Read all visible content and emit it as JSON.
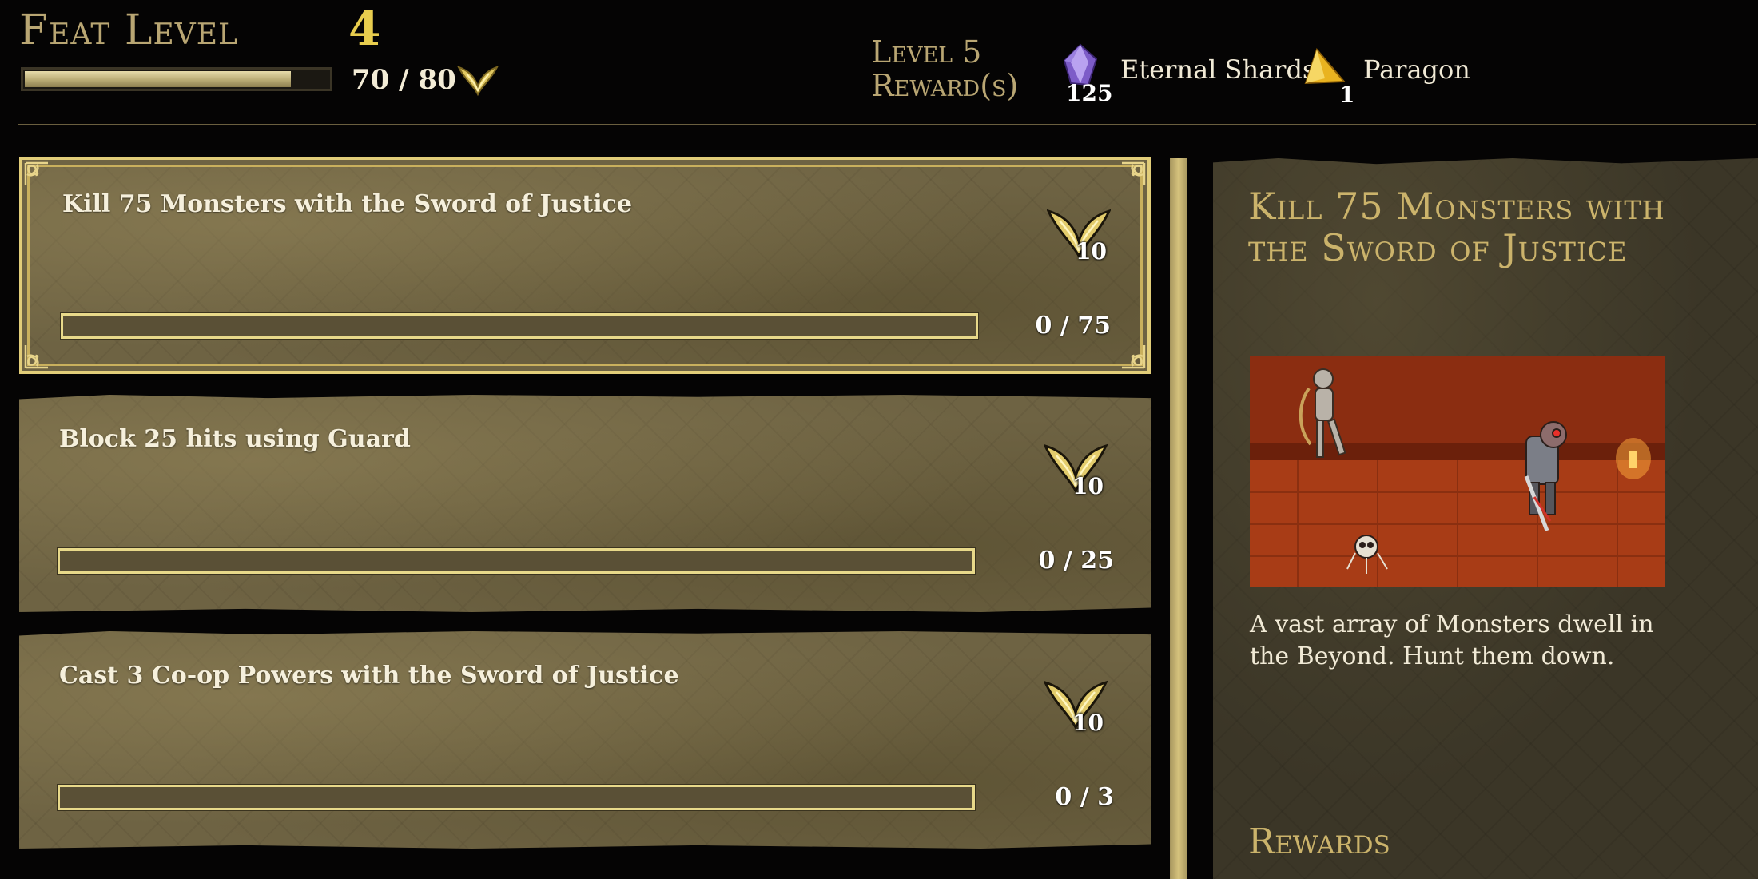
{
  "header": {
    "feat_label": "Feat Level",
    "feat_level": "4",
    "xp_text": "70 / 80",
    "xp_progress": 0.875,
    "reward_title": "Level 5 Reward(s)",
    "rewards": [
      {
        "count": "125",
        "label": "Eternal Shards",
        "icon": "purple-crystal-icon"
      },
      {
        "count": "1",
        "label": "Paragon",
        "icon": "gold-triangle-icon"
      }
    ]
  },
  "feats": [
    {
      "title": "Kill 75 Monsters with the Sword of Justice",
      "reward": "10",
      "progress_text": "0 / 75",
      "progress": 0,
      "selected": true
    },
    {
      "title": "Block 25 hits using Guard",
      "reward": "10",
      "progress_text": "0 / 25",
      "progress": 0,
      "selected": false
    },
    {
      "title": "Cast 3 Co-op Powers with the Sword of Justice",
      "reward": "10",
      "progress_text": "0 / 3",
      "progress": 0,
      "selected": false
    }
  ],
  "detail": {
    "title": "Kill 75 Monsters with the Sword of Justice",
    "description": "A vast array of Monsters dwell in the Beyond. Hunt them down.",
    "image": "dungeon-combat-preview",
    "rewards_heading": "Rewards"
  },
  "colors": {
    "gold": "#e8cd4e",
    "title_gold": "#cbb36b",
    "card_bg": "#6e6343",
    "bar_border": "#e8d98a"
  }
}
